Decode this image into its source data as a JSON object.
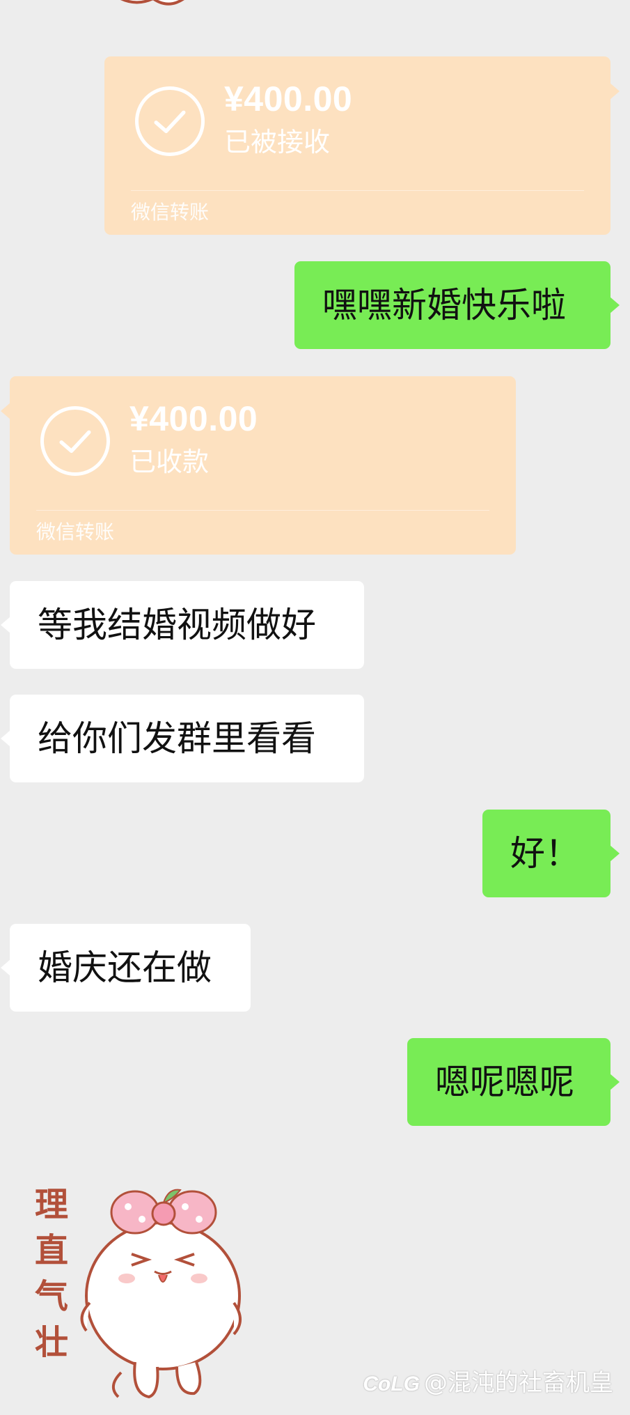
{
  "messages": [
    {
      "type": "transfer",
      "side": "right",
      "amount": "¥400.00",
      "status": "已被接收",
      "footer": "微信转账"
    },
    {
      "type": "text",
      "side": "right",
      "text": "嘿嘿新婚快乐啦"
    },
    {
      "type": "transfer",
      "side": "left",
      "amount": "¥400.00",
      "status": "已收款",
      "footer": "微信转账"
    },
    {
      "type": "text",
      "side": "left",
      "text": "等我结婚视频做好"
    },
    {
      "type": "text",
      "side": "left",
      "text": "给你们发群里看看"
    },
    {
      "type": "text",
      "side": "right",
      "text": "好！"
    },
    {
      "type": "text",
      "side": "left",
      "text": "婚庆还在做"
    },
    {
      "type": "text",
      "side": "right",
      "text": "嗯呢嗯呢"
    },
    {
      "type": "sticker",
      "side": "left",
      "caption_chars": [
        "理",
        "直",
        "气",
        "壮"
      ]
    }
  ],
  "watermark": {
    "logo": "CoLG",
    "text": "@混沌的社畜机皇"
  },
  "colors": {
    "background": "#ededed",
    "transfer_card": "#fde1c0",
    "outgoing_bubble": "#78ec55",
    "incoming_bubble": "#ffffff"
  },
  "icons": [
    "check-circle-icon",
    "sticker-character"
  ]
}
